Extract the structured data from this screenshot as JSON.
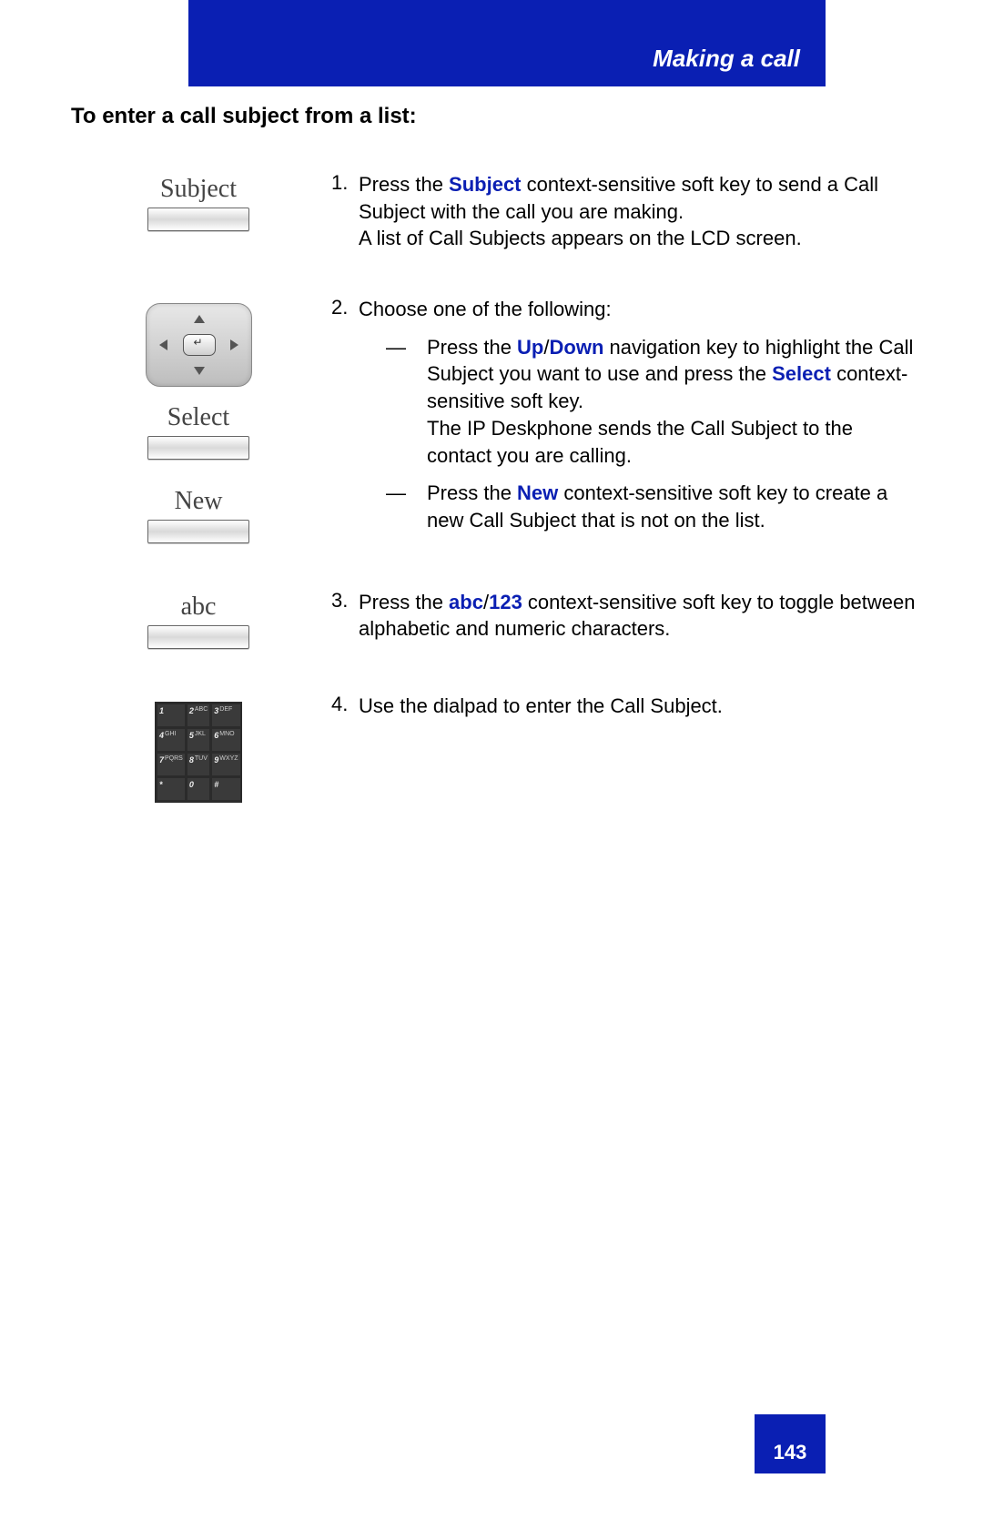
{
  "header": {
    "title": "Making a call"
  },
  "section_title": "To enter a call subject from a list:",
  "soft_labels": {
    "subject": "Subject",
    "select": "Select",
    "new": "New",
    "abc": "abc"
  },
  "steps": {
    "s1": {
      "num": "1.",
      "t1a": "Press the ",
      "k1": "Subject",
      "t1b": " context-sensitive soft key to send a Call Subject with the call you are making.",
      "t1c": "A list of Call Subjects appears on the LCD screen."
    },
    "s2": {
      "num": "2.",
      "intro": "Choose one of the following:",
      "dash": "—",
      "o1a": "Press the ",
      "o1k1": "Up",
      "o1sep": "/",
      "o1k2": "Down",
      "o1b": " navigation key to highlight the Call Subject you want to use and press the ",
      "o1k3": "Select",
      "o1c": " context-sensitive soft key.",
      "o1d": "The IP Deskphone sends the Call Subject to the contact you are calling.",
      "o2a": "Press the ",
      "o2k1": "New",
      "o2b": " context-sensitive soft key to create a new Call Subject that is not on the list."
    },
    "s3": {
      "num": "3.",
      "a": "Press the ",
      "k1": "abc",
      "sep": "/",
      "k2": "123",
      "b": " context-sensitive soft key to toggle between alphabetic and numeric characters."
    },
    "s4": {
      "num": "4.",
      "a": "Use the dialpad to enter the Call Subject."
    }
  },
  "dial_keys": [
    "1",
    "2",
    "3",
    "4",
    "5",
    "6",
    "7",
    "8",
    "9",
    "*",
    "0",
    "#"
  ],
  "dial_sub": [
    "",
    "ABC",
    "DEF",
    "GHI",
    "JKL",
    "MNO",
    "PQRS",
    "TUV",
    "WXYZ",
    "",
    "",
    ""
  ],
  "page_number": "143"
}
